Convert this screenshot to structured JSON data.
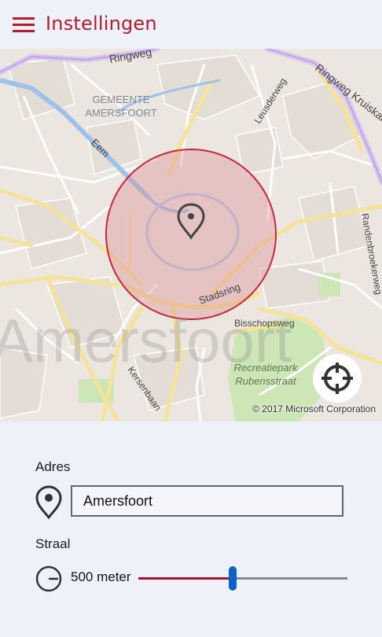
{
  "header": {
    "title": "Instellingen",
    "menu_icon": "hamburger-menu-icon",
    "accent": "#b51c2e"
  },
  "map": {
    "labels": {
      "district": [
        "GEMEENTE",
        "AMERSFOORT"
      ],
      "ringweg": "Ringweg",
      "ringweg_kruiskamp": "Ringweg Kruiskamp",
      "leusderweg": "Leusderweg",
      "randenbroekerweg": "Randenbroekerweg",
      "eem": "Eem",
      "stadsring": "Stadsring",
      "bisschopsweg": "Bisschopsweg",
      "recreatiepark": [
        "Recreatiepark",
        "Rubensstraat"
      ],
      "kersenbaan": "Kersenbaan",
      "city": "Amersfoort"
    },
    "copyright": "© 2017 Microsoft Corporation",
    "pin_icon": "map-pin-icon",
    "locate_icon": "crosshair-locate-icon",
    "radius_circle_color": "#c8283c"
  },
  "form": {
    "address_label": "Adres",
    "address_value": "Amersfoort",
    "address_icon": "location-pin-icon",
    "radius_label": "Straal",
    "radius_icon": "radius-gauge-icon",
    "radius_text": "500 meter",
    "slider_fraction": 0.45,
    "slider_fill_color": "#a0182b",
    "slider_thumb_color": "#0a63c9"
  }
}
